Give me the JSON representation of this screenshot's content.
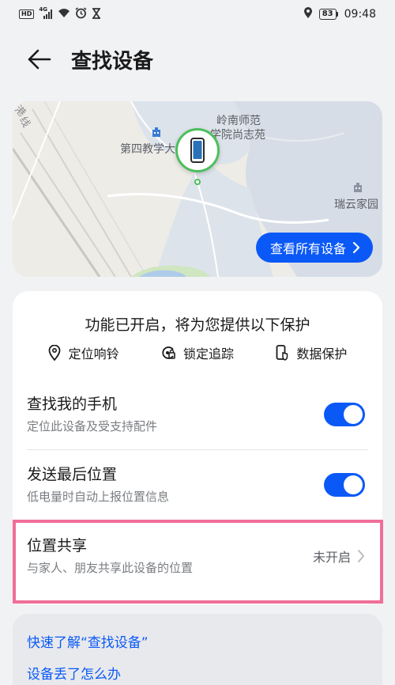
{
  "status_bar": {
    "network_tags": [
      "HD",
      "4G"
    ],
    "battery": "83",
    "time": "09:48",
    "icons": [
      "hd-icon",
      "signal-4g-icon",
      "wifi-icon",
      "alarm-icon",
      "hourglass-icon",
      "location-icon",
      "battery-icon"
    ]
  },
  "header": {
    "title": "查找设备",
    "back_icon": "arrow-left-icon"
  },
  "map": {
    "labels": {
      "top_left_partial": "港",
      "left_partial": "线",
      "building": "第四教学大",
      "campus_line1": "岭南师范",
      "campus_line2": "学院尚志苑",
      "residence": "瑞云家园"
    },
    "device_icon": "phone-icon",
    "view_all_button": "查看所有设备",
    "view_all_chevron": "chevron-right-icon",
    "accent_color": "#0a59f7",
    "pin_color": "#4cbf5c"
  },
  "protection": {
    "title": "功能已开启，将为您提供以下保护",
    "features": [
      {
        "icon": "location-pin-icon",
        "label": "定位响铃"
      },
      {
        "icon": "lock-track-icon",
        "label": "锁定追踪"
      },
      {
        "icon": "phone-shield-icon",
        "label": "数据保护"
      }
    ]
  },
  "settings": [
    {
      "title": "查找我的手机",
      "subtitle": "定位此设备及受支持配件",
      "toggle_on": true
    },
    {
      "title": "发送最后位置",
      "subtitle": "低电量时自动上报位置信息",
      "toggle_on": true
    },
    {
      "title": "位置共享",
      "subtitle": "与家人、朋友共享此设备的位置",
      "status": "未开启"
    }
  ],
  "help": {
    "links": [
      "快速了解“查找设备”",
      "设备丢了怎么办"
    ]
  },
  "highlight_color": "#f06e98"
}
